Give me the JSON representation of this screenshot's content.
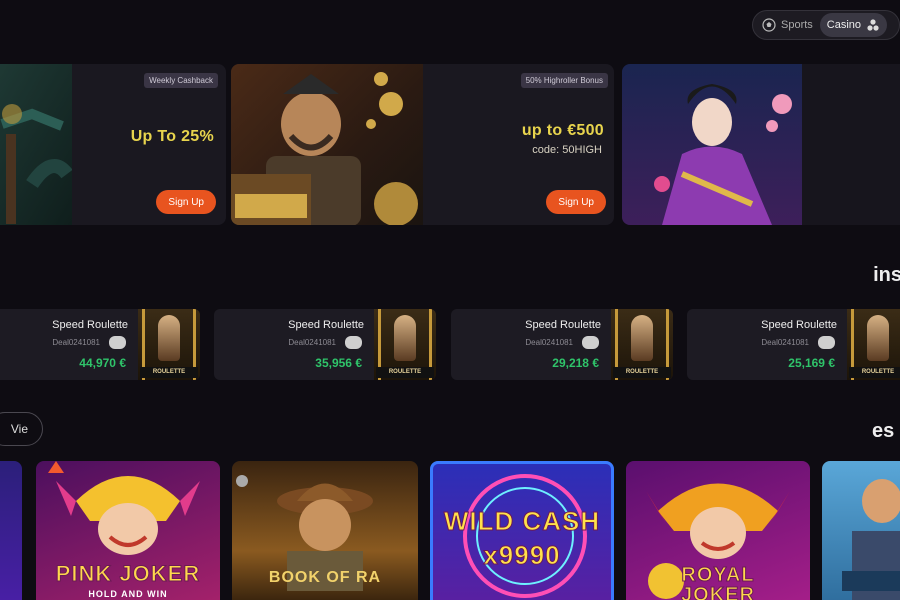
{
  "nav": {
    "casino_label": "Casino",
    "sports_label": "Sports",
    "casino_icon": "cards-icon",
    "sports_icon": "soccer-ball-icon"
  },
  "promos": [
    {
      "badge": "Weekly Cashback",
      "headline": "Up To 25%",
      "subline": "",
      "button": "Sign Up"
    },
    {
      "badge": "50% Highroller Bonus",
      "headline": "up to €500",
      "subline": "code: 50HIGH",
      "button": "Sign Up"
    }
  ],
  "sections": {
    "live_title": "ins",
    "games_title": "es",
    "view_label": "Vie"
  },
  "live_games": [
    {
      "name": "Speed Roulette",
      "id": "Deal0241081",
      "amount": "44,970 €",
      "thumb_label": "ROULETTE"
    },
    {
      "name": "Speed Roulette",
      "id": "Deal0241081",
      "amount": "35,956 €",
      "thumb_label": "ROULETTE"
    },
    {
      "name": "Speed Roulette",
      "id": "Deal0241081",
      "amount": "29,218 €",
      "thumb_label": "ROULETTE"
    },
    {
      "name": "Speed Roulette",
      "id": "Deal0241081",
      "amount": "25,169 €",
      "thumb_label": "ROULETTE"
    }
  ],
  "game_tiles": [
    {
      "title": "PINK JOKER",
      "sub": "HOLD AND WIN"
    },
    {
      "title": "BOOK OF RA",
      "sub": ""
    },
    {
      "title": "WILD CASH x9990",
      "sub": ""
    },
    {
      "title": "ROYAL JOKER",
      "sub": ""
    }
  ],
  "colors": {
    "accent": "#e8541f",
    "win_green": "#2fc46a",
    "headline_yellow": "#e8d44d",
    "background": "#0e0c12"
  }
}
